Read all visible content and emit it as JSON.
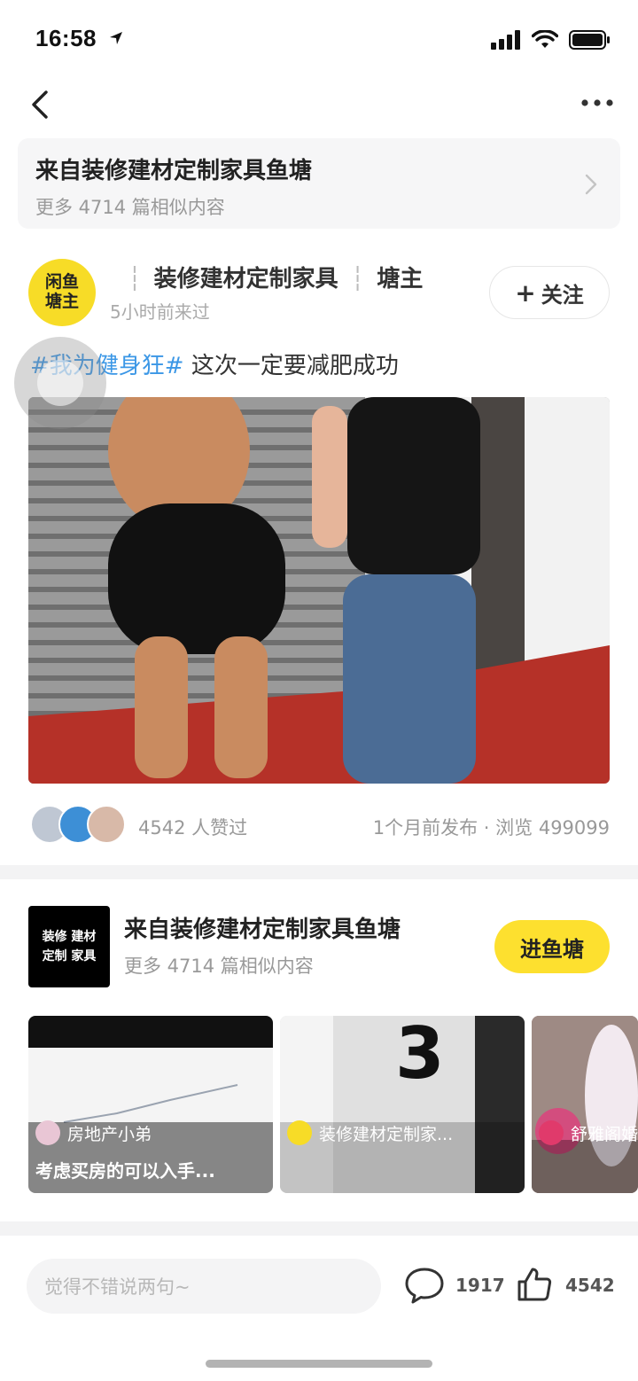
{
  "status_bar": {
    "time": "16:58"
  },
  "source_card": {
    "title": "来自装修建材定制家具鱼塘",
    "subtitle": "更多 4714 篇相似内容"
  },
  "post": {
    "author_badge_line1": "闲鱼",
    "author_badge_line2": "塘主",
    "author_name": "装修建材定制家具",
    "author_role": "塘主",
    "author_time": "5小时前来过",
    "follow_label": "关注",
    "hashtag": "#我为健身狂#",
    "text": " 这次一定要减肥成功",
    "likes": "4542 人赞过",
    "publish_info": "1个月前发布 · 浏览 499099"
  },
  "pond": {
    "logo_line1": "装修 建材",
    "logo_line2": "定制 家具",
    "title": "来自装修建材定制家具鱼塘",
    "subtitle": "更多 4714 篇相似内容",
    "enter_label": "进鱼塘",
    "thumbs": [
      {
        "user": "房地产小弟",
        "caption": "考虑买房的可以入手..."
      },
      {
        "user": "装修建材定制家...",
        "caption": ""
      },
      {
        "user": "舒雅阁婚",
        "caption": ""
      }
    ]
  },
  "bottom_bar": {
    "comment_placeholder": "觉得不错说两句~",
    "comment_count": "1917",
    "like_count": "4542"
  },
  "colors": {
    "accent_yellow": "#fde02f",
    "hashtag_blue": "#3b97e6",
    "muted_text": "#999999"
  }
}
